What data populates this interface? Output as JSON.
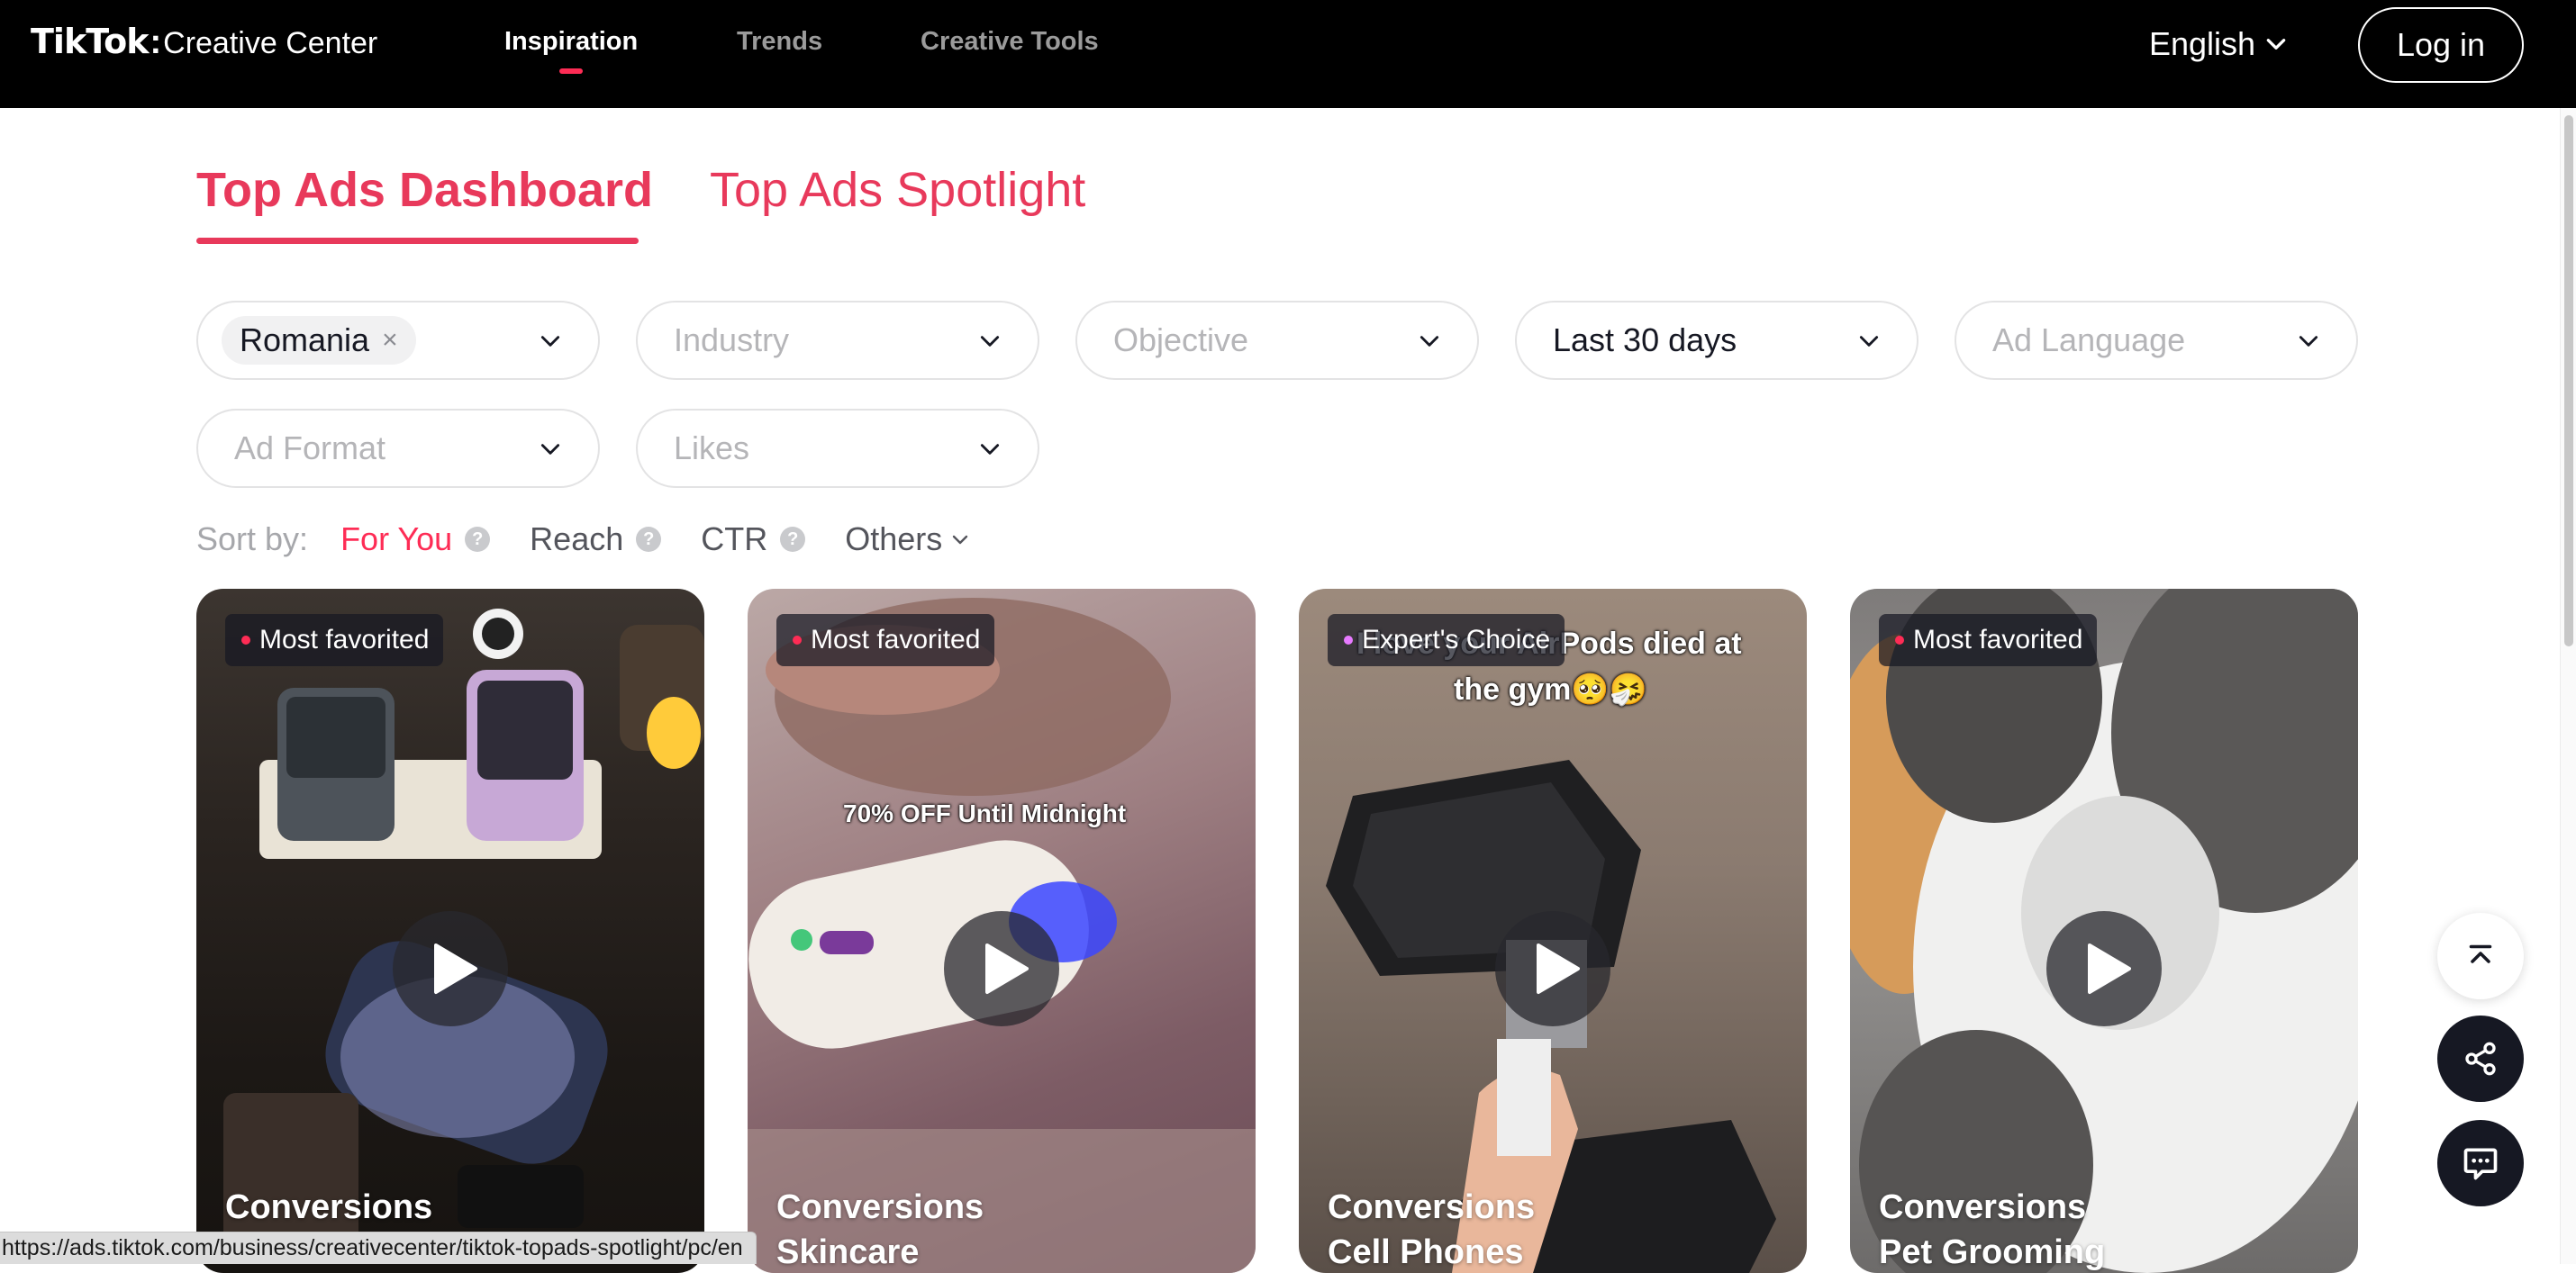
{
  "nav": {
    "logo_brand": "TikTok",
    "logo_product": "Creative Center",
    "links": [
      {
        "label": "Inspiration",
        "active": true
      },
      {
        "label": "Trends",
        "active": false
      },
      {
        "label": "Creative Tools",
        "active": false
      }
    ],
    "language": "English",
    "login_label": "Log in"
  },
  "tabs": [
    {
      "label": "Top Ads Dashboard",
      "active": true
    },
    {
      "label": "Top Ads Spotlight",
      "active": false
    }
  ],
  "filters": {
    "country_chip": "Romania",
    "industry_placeholder": "Industry",
    "objective_placeholder": "Objective",
    "period_value": "Last 30 days",
    "language_placeholder": "Ad Language",
    "format_placeholder": "Ad Format",
    "likes_placeholder": "Likes"
  },
  "sort": {
    "label": "Sort by:",
    "options": [
      {
        "label": "For You",
        "active": true
      },
      {
        "label": "Reach",
        "active": false
      },
      {
        "label": "CTR",
        "active": false
      }
    ],
    "others_label": "Others"
  },
  "cards": [
    {
      "badge": "Most favorited",
      "badge_color": "#fe2c55",
      "objective": "Conversions",
      "industry": ""
    },
    {
      "badge": "Most favorited",
      "badge_color": "#fe2c55",
      "objective": "Conversions",
      "industry": "Skincare",
      "overlay": "70% OFF Until Midnight"
    },
    {
      "badge": "Expert's Choice",
      "badge_color": "#e77aff",
      "objective": "Conversions",
      "industry": "Cell Phones",
      "overlay_line1": "I love your AirPods died at",
      "overlay_line2": "the gym🥺🤧"
    },
    {
      "badge": "Most favorited",
      "badge_color": "#fe2c55",
      "objective": "Conversions",
      "industry": "Pet Grooming"
    }
  ],
  "icons": {
    "back_to_top": "back-to-top-icon",
    "share": "share-icon",
    "feedback": "chat-icon",
    "play": "play-icon"
  },
  "status_url": "https://ads.tiktok.com/business/creativecenter/tiktok-topads-spotlight/pc/en",
  "colors": {
    "accent": "#fe2c55",
    "tab": "#e8395b",
    "nav_bg": "#000000"
  }
}
